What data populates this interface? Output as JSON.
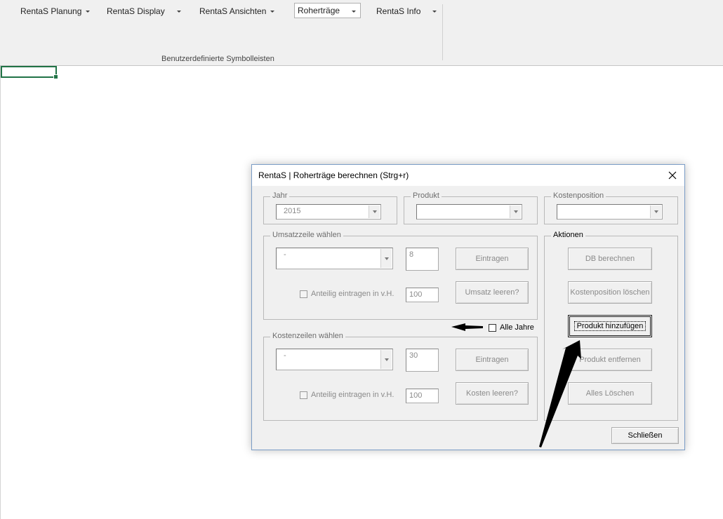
{
  "ribbon": {
    "menus": [
      {
        "label": "RentaS Planung"
      },
      {
        "label": "RentaS Display"
      },
      {
        "label": "RentaS Ansichten"
      }
    ],
    "combo_value": "Roherträge",
    "info_menu": "RentaS Info",
    "group_label": "Benutzerdefinierte Symbolleisten"
  },
  "dialog": {
    "title": "RentaS | Roherträge berechnen (Strg+r)",
    "jahr": {
      "label": "Jahr",
      "value": "2015"
    },
    "produkt": {
      "label": "Produkt",
      "value": ""
    },
    "kostenposition": {
      "label": "Kostenposition",
      "value": ""
    },
    "umsatz": {
      "label": "Umsatzzeile wählen",
      "combo_value": "-",
      "number": "8",
      "eintragen": "Eintragen",
      "anteilig": "Anteilig eintragen in v.H.",
      "percent": "100",
      "leeren": "Umsatz leeren?"
    },
    "alle_jahre": "Alle Jahre",
    "kosten": {
      "label": "Kostenzeilen wählen",
      "combo_value": "-",
      "number": "30",
      "eintragen": "Eintragen",
      "anteilig": "Anteilig eintragen in v.H.",
      "percent": "100",
      "leeren": "Kosten leeren?"
    },
    "aktionen": {
      "label": "Aktionen",
      "db_berechnen": "DB berechnen",
      "kostenposition_loeschen": "Kostenposition löschen",
      "produkt_hinzufuegen": "Produkt hinzufügen",
      "produkt_entfernen": "Produkt entfernen",
      "alles_loeschen": "Alles Löschen"
    },
    "schliessen": "Schließen"
  },
  "colors": {
    "ribbon_bg": "#f0f0f0",
    "selection": "#217346",
    "dialog_bg": "#f0f0f0",
    "disabled_text": "#8a8a8a"
  }
}
